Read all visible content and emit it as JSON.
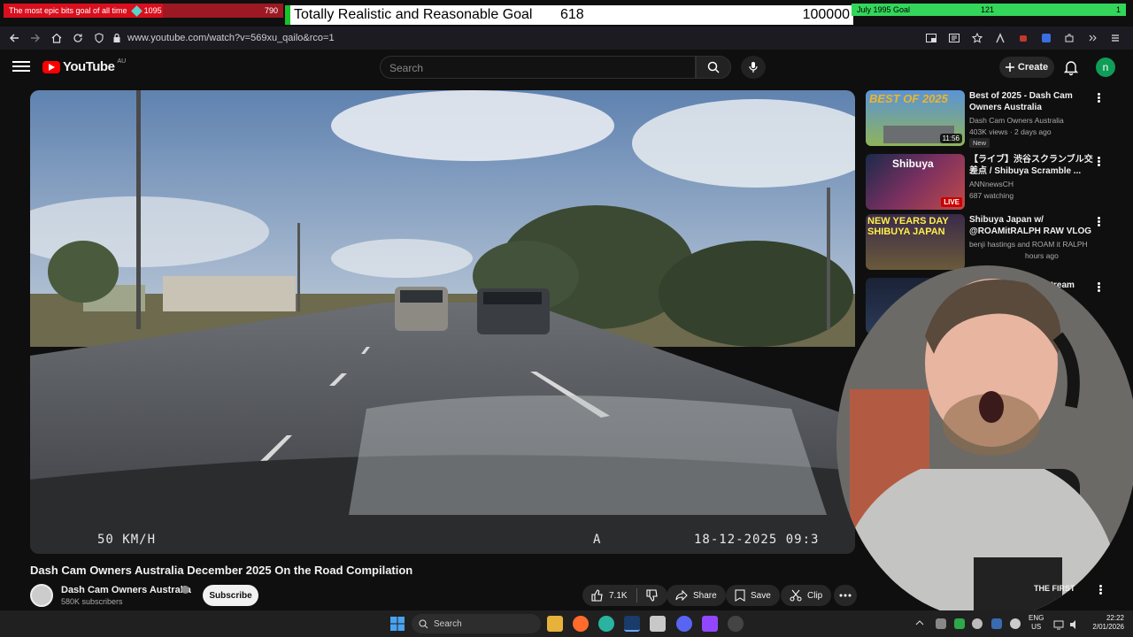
{
  "goals": {
    "left": {
      "title": "The most epic bits goal of all time",
      "current": "1095",
      "max": "790"
    },
    "center": {
      "title": "Totally Realistic and Reasonable Goal",
      "current": "618",
      "max": "100000"
    },
    "right": {
      "title": "July 1995 Goal",
      "current": "121",
      "max": "1"
    }
  },
  "browser": {
    "url": "www.youtube.com/watch?v=569xu_qailo&rco=1"
  },
  "youtube": {
    "logo_text": "YouTube",
    "country": "AU",
    "search_placeholder": "Search",
    "create_label": "Create",
    "avatar_letter": "n"
  },
  "video": {
    "overlay_speed": "50 KM/H",
    "overlay_mode": "A",
    "overlay_datetime": "18-12-2025 09:3",
    "title": "Dash Cam Owners Australia December 2025 On the Road Compilation",
    "channel": "Dash Cam Owners Australia",
    "subscribers": "580K subscribers",
    "subscribe_label": "Subscribe",
    "likes": "7.1K",
    "share_label": "Share",
    "save_label": "Save",
    "clip_label": "Clip"
  },
  "recommendations": [
    {
      "title": "Best of 2025 - Dash Cam Owners Australia",
      "channel": "Dash Cam Owners Australia",
      "meta": "403K views · 2 days ago",
      "badge": "New",
      "duration": "11:56",
      "thumb_text": "BEST OF 2025"
    },
    {
      "title": "【ライブ】渋谷スクランブル交差点 / Shibuya Scramble ...",
      "channel": "ANNnewsCH",
      "meta": "687 watching",
      "badge": "LIVE",
      "thumb_text": "Shibuya"
    },
    {
      "title": "Shibuya Japan w/ @ROAMitRALPH RAW VLOG",
      "channel": "benji hastings and ROAM it RALPH",
      "meta": "hours ago",
      "thumb_text": "NEW YEARS DAY SHIBUYA JAPAN"
    },
    {
      "title": "Stream",
      "channel": "",
      "meta": ""
    },
    {
      "title": "",
      "channel": "",
      "meta": ""
    },
    {
      "title": "",
      "channel": "",
      "meta": ""
    },
    {
      "title": "THE FIRST",
      "channel": "",
      "meta": ""
    }
  ],
  "taskbar": {
    "search_label": "Search",
    "lang_line1": "ENG",
    "lang_line2": "US",
    "time": "22:22",
    "date": "2/01/2026"
  },
  "colors": {
    "yt_red": "#ff0000",
    "goal_red": "#d90f1e",
    "goal_green": "#33d65a",
    "background": "#0f0f0f"
  }
}
